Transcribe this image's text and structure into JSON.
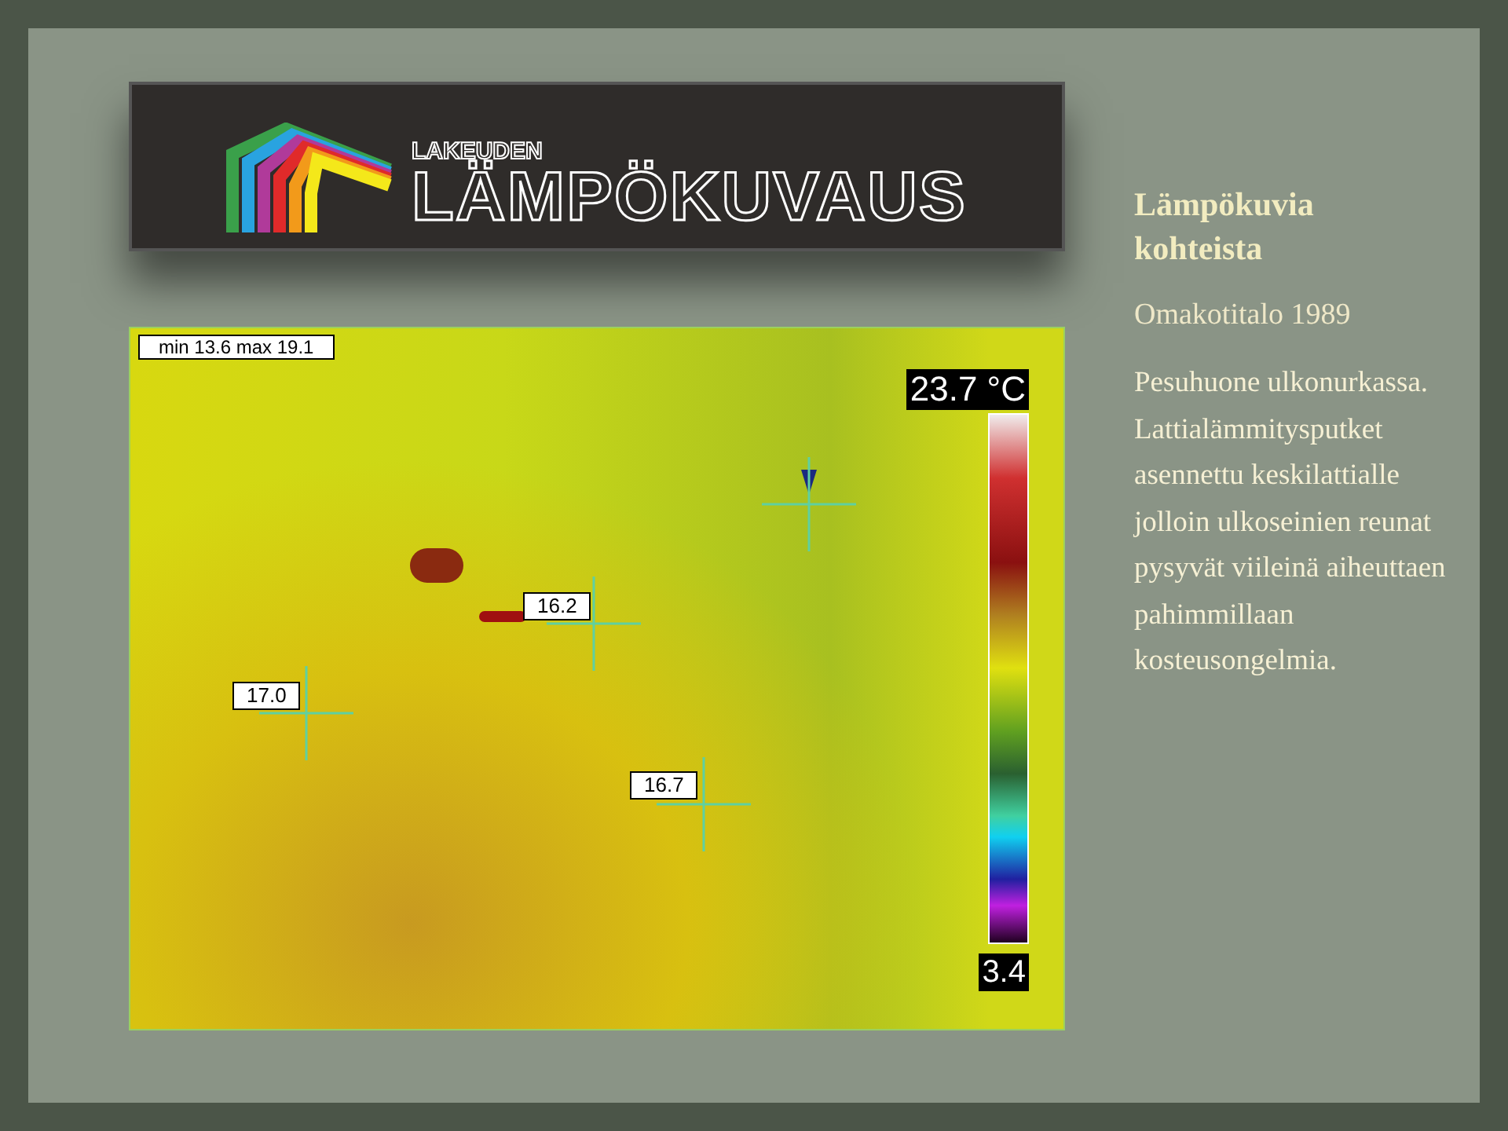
{
  "logo": {
    "small_text": "LAKEUDEN",
    "large_text": "LÄMPÖKUVAUS"
  },
  "thermal_image": {
    "range_label": "min 13.6 max 19.1",
    "scale_max": "23.7 °C",
    "scale_min": "3.4",
    "spots": [
      {
        "reading": "16.2",
        "kind": "label"
      },
      {
        "reading": "17.0",
        "kind": "label"
      },
      {
        "reading": "16.7",
        "kind": "label"
      }
    ]
  },
  "title": "Lämpökuvia kohteista",
  "subtitle": "Omakotitalo 1989",
  "description": "Pesuhuone ulkonurkassa. Lattialämmitysputket asennettu keskilattialle jolloin ulkoseinien reunat pysyvät viileinä aiheuttaen pahimmillaan kosteusongelmia."
}
